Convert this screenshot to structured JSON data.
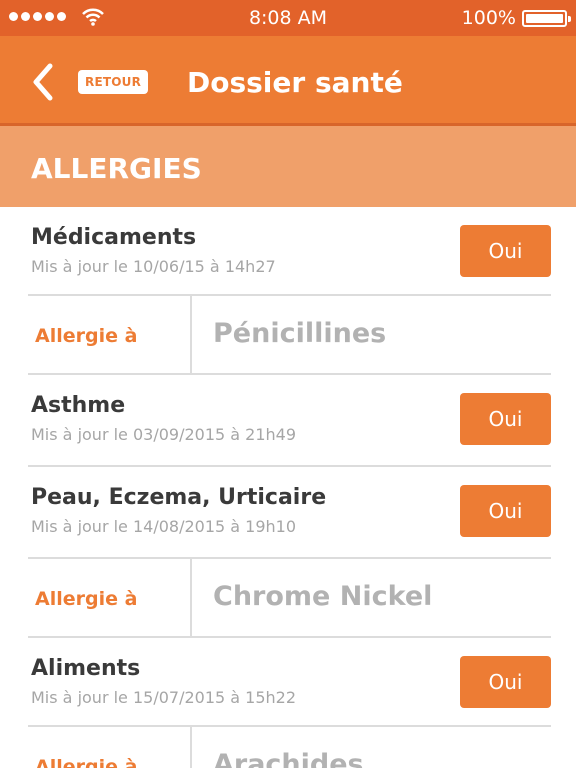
{
  "status_bar": {
    "time": "8:08 AM",
    "battery": "100%",
    "signal_icon": "signal-dots-icon",
    "wifi_icon": "wifi-icon",
    "battery_icon": "battery-icon"
  },
  "nav": {
    "back_icon": "chevron-left-icon",
    "back_label": "RETOUR",
    "title": "Dossier santé"
  },
  "section": {
    "title": "ALLERGIES"
  },
  "items": [
    {
      "name": "Médicaments",
      "updated": "Mis à jour le 10/06/15 à 14h27",
      "button": "Oui",
      "allergen_label": "Allergie à",
      "allergen": "Pénicillines"
    },
    {
      "name": "Asthme",
      "updated": "Mis à jour le 03/09/2015 à 21h49",
      "button": "Oui"
    },
    {
      "name": "Peau, Eczema, Urticaire",
      "updated": "Mis à jour le 14/08/2015 à 19h10",
      "button": "Oui",
      "allergen_label": "Allergie à",
      "allergen": "Chrome Nickel"
    },
    {
      "name": "Aliments",
      "updated": "Mis à jour le 15/07/2015 à 15h22",
      "button": "Oui",
      "allergen_label": "Allergie à",
      "allergen": "Arachides"
    }
  ],
  "colors": {
    "status_bar": "#e2622a",
    "nav_bar": "#ed7c34",
    "section_header": "#f0a06a",
    "accent": "#ed7c34"
  }
}
